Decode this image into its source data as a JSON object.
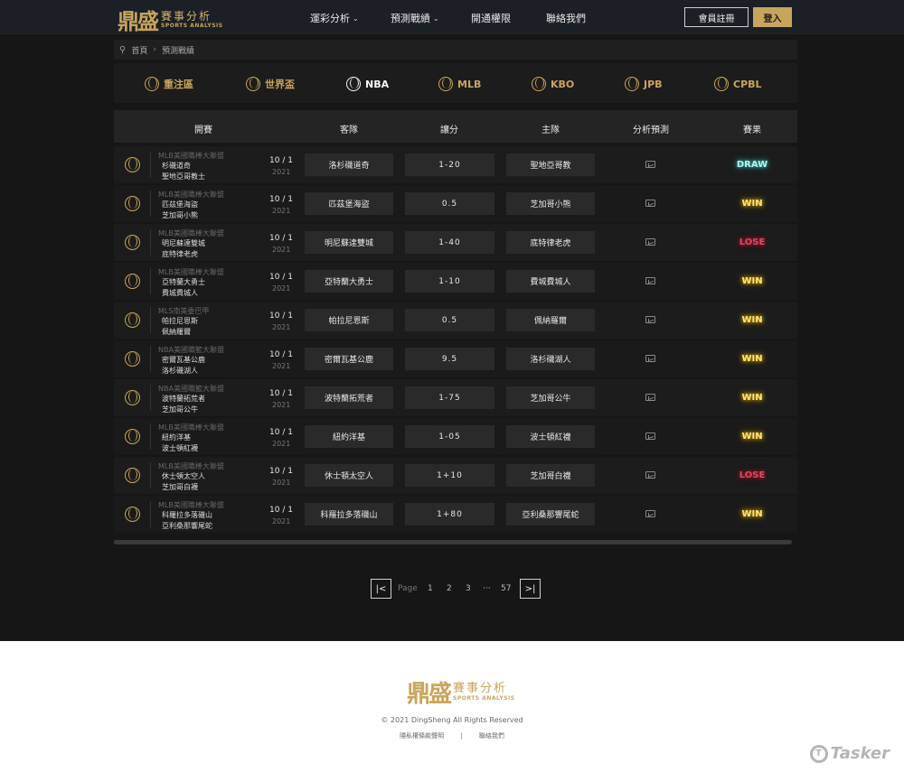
{
  "header": {
    "logo": {
      "big": "鼎盛",
      "cn": "賽事分析",
      "en": "SPORTS ANALYSIS"
    },
    "nav": [
      {
        "label": "運彩分析",
        "dropdown": true
      },
      {
        "label": "預測戰績",
        "dropdown": true
      },
      {
        "label": "開通權限",
        "dropdown": false
      },
      {
        "label": "聯絡我們",
        "dropdown": false
      }
    ],
    "register_label": "會員註冊",
    "login_label": "登入"
  },
  "breadcrumb": {
    "home": "首頁",
    "current": "預測戰績"
  },
  "tabs": [
    {
      "label": "重注區",
      "active": false
    },
    {
      "label": "世界盃",
      "active": false
    },
    {
      "label": "NBA",
      "active": true
    },
    {
      "label": "MLB",
      "active": false
    },
    {
      "label": "KBO",
      "active": false
    },
    {
      "label": "JPB",
      "active": false
    },
    {
      "label": "CPBL",
      "active": false
    }
  ],
  "table": {
    "headers": [
      "開賽",
      "客隊",
      "讓分",
      "主隊",
      "分析預測",
      "賽果"
    ],
    "rows": [
      {
        "sport": "baseball",
        "league": "MLB美國職棒大聯盟",
        "team1": "杉磯道奇",
        "team2": "聖地亞哥教士",
        "date": "10 / 1",
        "year": "2021",
        "away": "洛杉磯道奇",
        "handicap": "1-20",
        "home": "聖地亞哥教",
        "result": "DRAW"
      },
      {
        "sport": "baseball",
        "league": "MLB美國職棒大聯盟",
        "team1": "匹茲堡海盜",
        "team2": "芝加哥小熊",
        "date": "10 / 1",
        "year": "2021",
        "away": "匹茲堡海盜",
        "handicap": "0.5",
        "home": "芝加哥小熊",
        "result": "WIN"
      },
      {
        "sport": "baseball",
        "league": "MLB美國職棒大聯盟",
        "team1": "明尼蘇達雙城",
        "team2": "底特律老虎",
        "date": "10 / 1",
        "year": "2021",
        "away": "明尼蘇達雙城",
        "handicap": "1-40",
        "home": "底特律老虎",
        "result": "LOSE"
      },
      {
        "sport": "baseball",
        "league": "MLB美國職棒大聯盟",
        "team1": "亞特蘭大勇士",
        "team2": "費城費城人",
        "date": "10 / 1",
        "year": "2021",
        "away": "亞特蘭大勇士",
        "handicap": "1-10",
        "home": "費城費城人",
        "result": "WIN"
      },
      {
        "sport": "basketball",
        "league": "MLS南美委巴甲",
        "team1": "帕拉尼恩斯",
        "team2": "佩納羅爾",
        "date": "10 / 1",
        "year": "2021",
        "away": "帕拉尼恩斯",
        "handicap": "0.5",
        "home": "佩納羅爾",
        "result": "WIN"
      },
      {
        "sport": "basketball",
        "league": "NBA美國職籃大聯盟",
        "team1": "密爾瓦基公鹿",
        "team2": "洛杉磯湖人",
        "date": "10 / 1",
        "year": "2021",
        "away": "密爾瓦基公鹿",
        "handicap": "9.5",
        "home": "洛杉磯湖人",
        "result": "WIN"
      },
      {
        "sport": "basketball",
        "league": "NBA美國職籃大聯盟",
        "team1": "波特蘭拓荒者",
        "team2": "芝加哥公牛",
        "date": "10 / 1",
        "year": "2021",
        "away": "波特蘭拓荒者",
        "handicap": "1-75",
        "home": "芝加哥公牛",
        "result": "WIN"
      },
      {
        "sport": "baseball",
        "league": "MLB美國職棒大聯盟",
        "team1": "紐約洋基",
        "team2": "波士頓紅襪",
        "date": "10 / 1",
        "year": "2021",
        "away": "紐約洋基",
        "handicap": "1-05",
        "home": "波士頓紅襪",
        "result": "WIN"
      },
      {
        "sport": "baseball",
        "league": "MLB美國職棒大聯盟",
        "team1": "休士頓太空人",
        "team2": "芝加哥白襪",
        "date": "10 / 1",
        "year": "2021",
        "away": "休士頓太空人",
        "handicap": "1+10",
        "home": "芝加哥白襪",
        "result": "LOSE"
      },
      {
        "sport": "baseball",
        "league": "MLB美國職棒大聯盟",
        "team1": "科羅拉多落磯山",
        "team2": "亞利桑那響尾蛇",
        "date": "10 / 1",
        "year": "2021",
        "away": "科羅拉多落磯山",
        "handicap": "1+80",
        "home": "亞利桑那響尾蛇",
        "result": "WIN"
      }
    ]
  },
  "pagination": {
    "first": "|<",
    "label": "Page",
    "pages": [
      "1",
      "2",
      "3"
    ],
    "ellipsis": "···",
    "last_page": "57",
    "last": ">|"
  },
  "footer": {
    "logo": {
      "big": "鼎盛",
      "cn": "賽事分析",
      "en": "SPORTS ANALYSIS"
    },
    "copyright": "© 2021 DingSheng All Rights Reserved",
    "links": [
      "隱私權條款聲明",
      "|",
      "聯絡我們"
    ]
  },
  "watermark": "Tasker",
  "colors": {
    "accent": "#c9a45c",
    "win": "#ffe37a",
    "draw": "#b8f0ee",
    "lose": "#e0475f"
  }
}
